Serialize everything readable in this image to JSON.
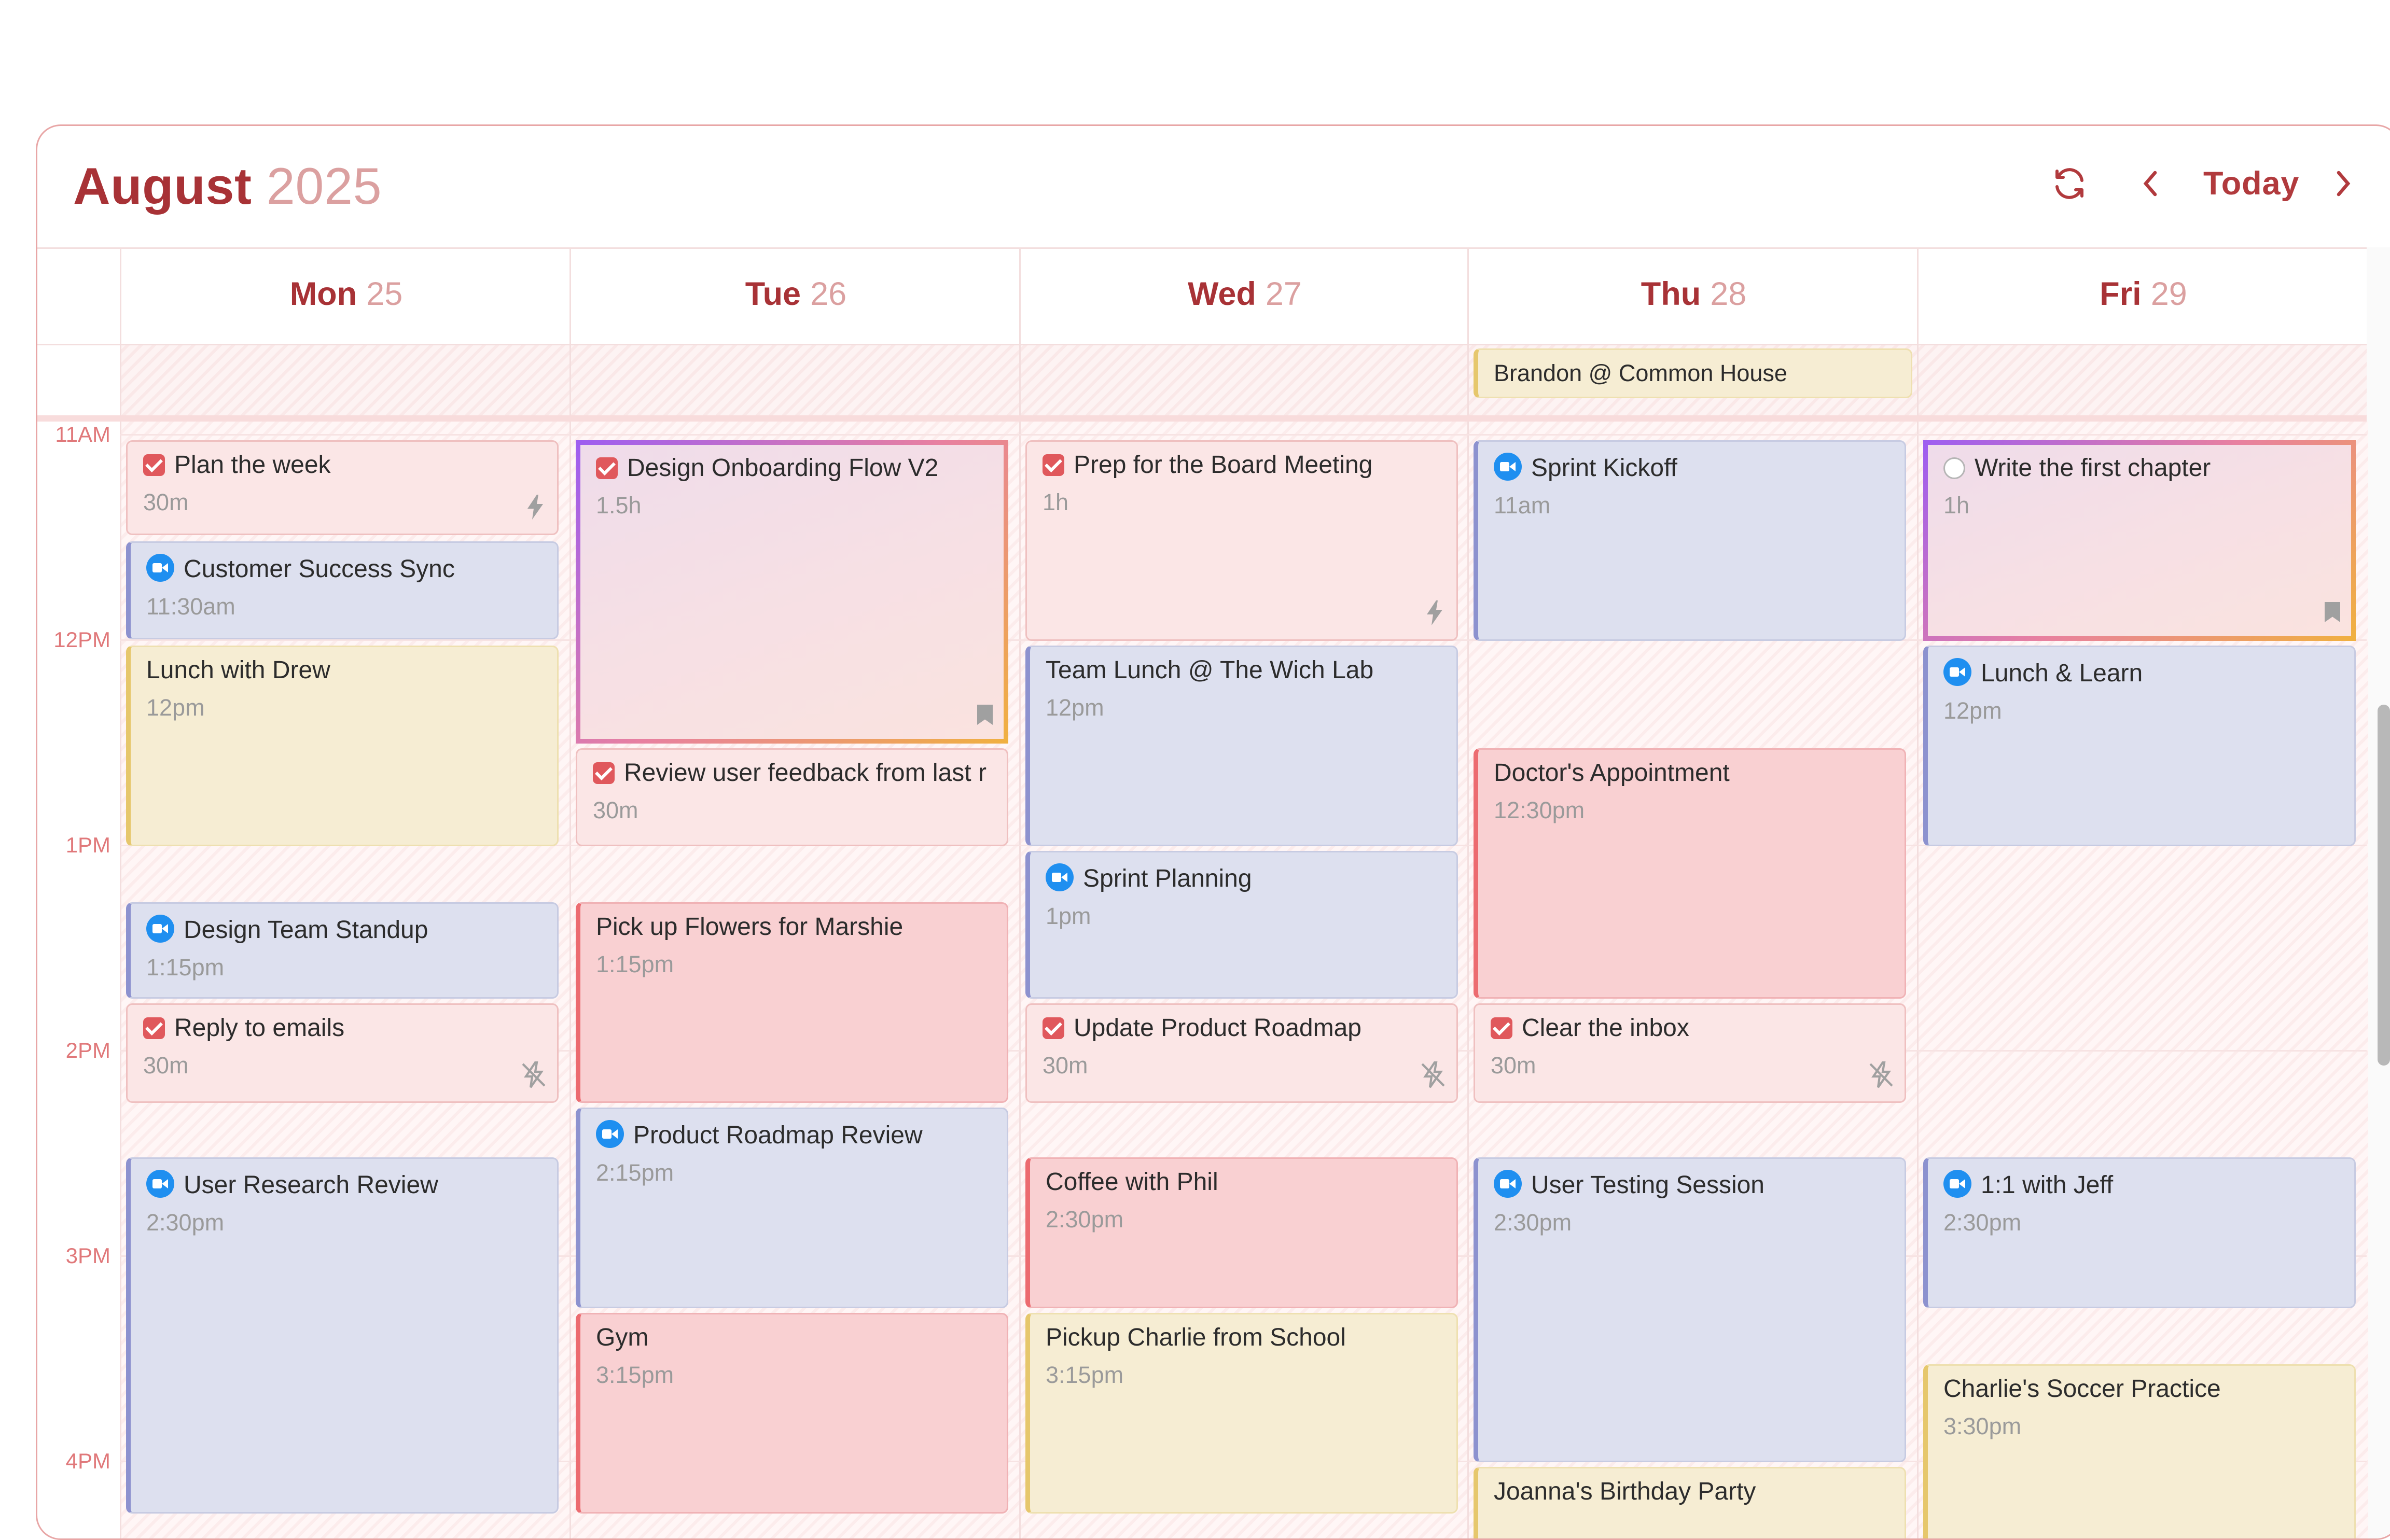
{
  "header": {
    "month": "August",
    "year": "2025",
    "today_label": "Today"
  },
  "days": [
    {
      "name": "Mon",
      "date": "25"
    },
    {
      "name": "Tue",
      "date": "26"
    },
    {
      "name": "Wed",
      "date": "27"
    },
    {
      "name": "Thu",
      "date": "28"
    },
    {
      "name": "Fri",
      "date": "29"
    }
  ],
  "all_day": {
    "thu": "Brandon @ Common House"
  },
  "hours": [
    "11AM",
    "12PM",
    "1PM",
    "2PM",
    "3PM",
    "4PM"
  ],
  "events": {
    "mon": [
      {
        "title": "Plan the week",
        "sub": "30m"
      },
      {
        "title": "Customer Success Sync",
        "sub": "11:30am"
      },
      {
        "title": "Lunch with Drew",
        "sub": "12pm"
      },
      {
        "title": "Design Team Standup",
        "sub": "1:15pm"
      },
      {
        "title": "Reply to emails",
        "sub": "30m"
      },
      {
        "title": "User Research Review",
        "sub": "2:30pm"
      }
    ],
    "tue": [
      {
        "title": "Design Onboarding Flow V2",
        "sub": "1.5h"
      },
      {
        "title": "Review user feedback from last r",
        "sub": "30m"
      },
      {
        "title": "Pick up Flowers for Marshie",
        "sub": "1:15pm"
      },
      {
        "title": "Product Roadmap Review",
        "sub": "2:15pm"
      },
      {
        "title": "Gym",
        "sub": "3:15pm"
      }
    ],
    "wed": [
      {
        "title": "Prep for the Board Meeting",
        "sub": "1h"
      },
      {
        "title": "Team Lunch @ The Wich Lab",
        "sub": "12pm"
      },
      {
        "title": "Sprint Planning",
        "sub": "1pm"
      },
      {
        "title": "Update Product Roadmap",
        "sub": "30m"
      },
      {
        "title": "Coffee with Phil",
        "sub": "2:30pm"
      },
      {
        "title": "Pickup Charlie from School",
        "sub": "3:15pm"
      }
    ],
    "thu": [
      {
        "title": "Sprint Kickoff",
        "sub": "11am"
      },
      {
        "title": "Doctor's Appointment",
        "sub": "12:30pm"
      },
      {
        "title": "Clear the inbox",
        "sub": "30m"
      },
      {
        "title": "User Testing Session",
        "sub": "2:30pm"
      },
      {
        "title": "Joanna's Birthday Party",
        "sub": ""
      }
    ],
    "fri": [
      {
        "title": "Write the first chapter",
        "sub": "1h"
      },
      {
        "title": "Lunch & Learn",
        "sub": "12pm"
      },
      {
        "title": "1:1 with Jeff",
        "sub": "2:30pm"
      },
      {
        "title": "Charlie's Soccer Practice",
        "sub": "3:30pm"
      }
    ]
  },
  "icons": {
    "task_done": "checkbox-checked-icon",
    "task_open": "checkbox-empty-icon",
    "meeting": "video-call-icon",
    "auto": "lightning-icon",
    "unscheduled": "lightning-off-icon",
    "focus": "bookmark-icon"
  },
  "colors": {
    "accent": "#a83236",
    "hour_label": "#e0787a",
    "meeting_blue": "#1f8ff0",
    "task_red": "#e0585c"
  }
}
